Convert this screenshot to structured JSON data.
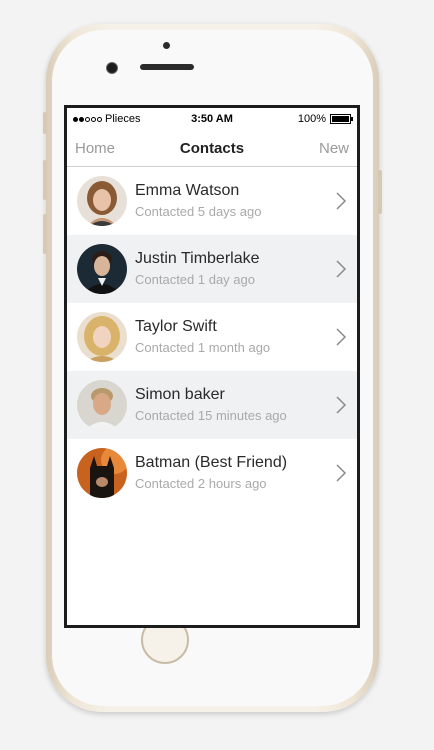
{
  "status_bar": {
    "carrier": "Plieces",
    "time": "3:50 AM",
    "battery": "100%",
    "battery_level": 1.0
  },
  "nav": {
    "left": "Home",
    "title": "Contacts",
    "right": "New"
  },
  "contacts": [
    {
      "name": "Emma Watson",
      "subtitle": "Contacted 5 days ago"
    },
    {
      "name": "Justin Timberlake",
      "subtitle": "Contacted 1 day ago"
    },
    {
      "name": "Taylor Swift",
      "subtitle": "Contacted 1 month ago"
    },
    {
      "name": "Simon baker",
      "subtitle": "Contacted 15 minutes ago"
    },
    {
      "name": "Batman (Best Friend)",
      "subtitle": "Contacted 2 hours ago"
    }
  ],
  "icons": {
    "chevron": "chevron-right-icon"
  },
  "colors": {
    "alt_row": "#f0f1f3",
    "nav_button": "#9a9a9a",
    "subtitle": "#a9a9a9"
  }
}
